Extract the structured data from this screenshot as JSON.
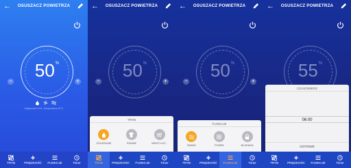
{
  "app": {
    "title": "OSUSZACZ POWIETRZA",
    "unit": "%",
    "info_line": "Wilgotność 91%, Temperatura 25°C"
  },
  "nav": [
    {
      "label": "TRYB",
      "icon": "mode-icon"
    },
    {
      "label": "PRĘDKOŚĆ",
      "icon": "fan-speed-icon"
    },
    {
      "label": "FUNKCJE",
      "icon": "menu-icon"
    },
    {
      "label": "Timer",
      "icon": "clock-icon"
    }
  ],
  "screens": [
    {
      "value": "50",
      "active_nav": -1
    },
    {
      "value": "50",
      "active_nav": 0
    },
    {
      "value": "50",
      "active_nav": 2
    },
    {
      "value": "55",
      "active_nav": 3
    }
  ],
  "mode_sheet": {
    "title": "TRYB",
    "options": [
      {
        "label": "OSUSZANIE",
        "icon": "dehumidify-icon",
        "selected": true
      },
      {
        "label": "PRANIE",
        "icon": "laundry-icon",
        "selected": false
      },
      {
        "label": "WENTYLAT...",
        "icon": "ventilation-icon",
        "selected": false
      }
    ]
  },
  "function_sheet": {
    "title": "FUNKCJE",
    "options": [
      {
        "label": "SWING",
        "icon": "swing-icon",
        "selected": true
      },
      {
        "label": "POMPA",
        "icon": "pump-icon",
        "selected": false
      },
      {
        "label": "BLOKADA",
        "icon": "lock-icon",
        "selected": false
      }
    ]
  },
  "timer_sheet": {
    "title": "CZASOMIERZ",
    "rows": [
      "",
      "",
      "",
      "06:00",
      "",
      ""
    ],
    "selected_row": "06:00",
    "done_label": "GOTOWE"
  },
  "colors": {
    "accent": "#f5a623",
    "bg_top": "#2e7ff0",
    "bg_bottom": "#2747d8"
  }
}
